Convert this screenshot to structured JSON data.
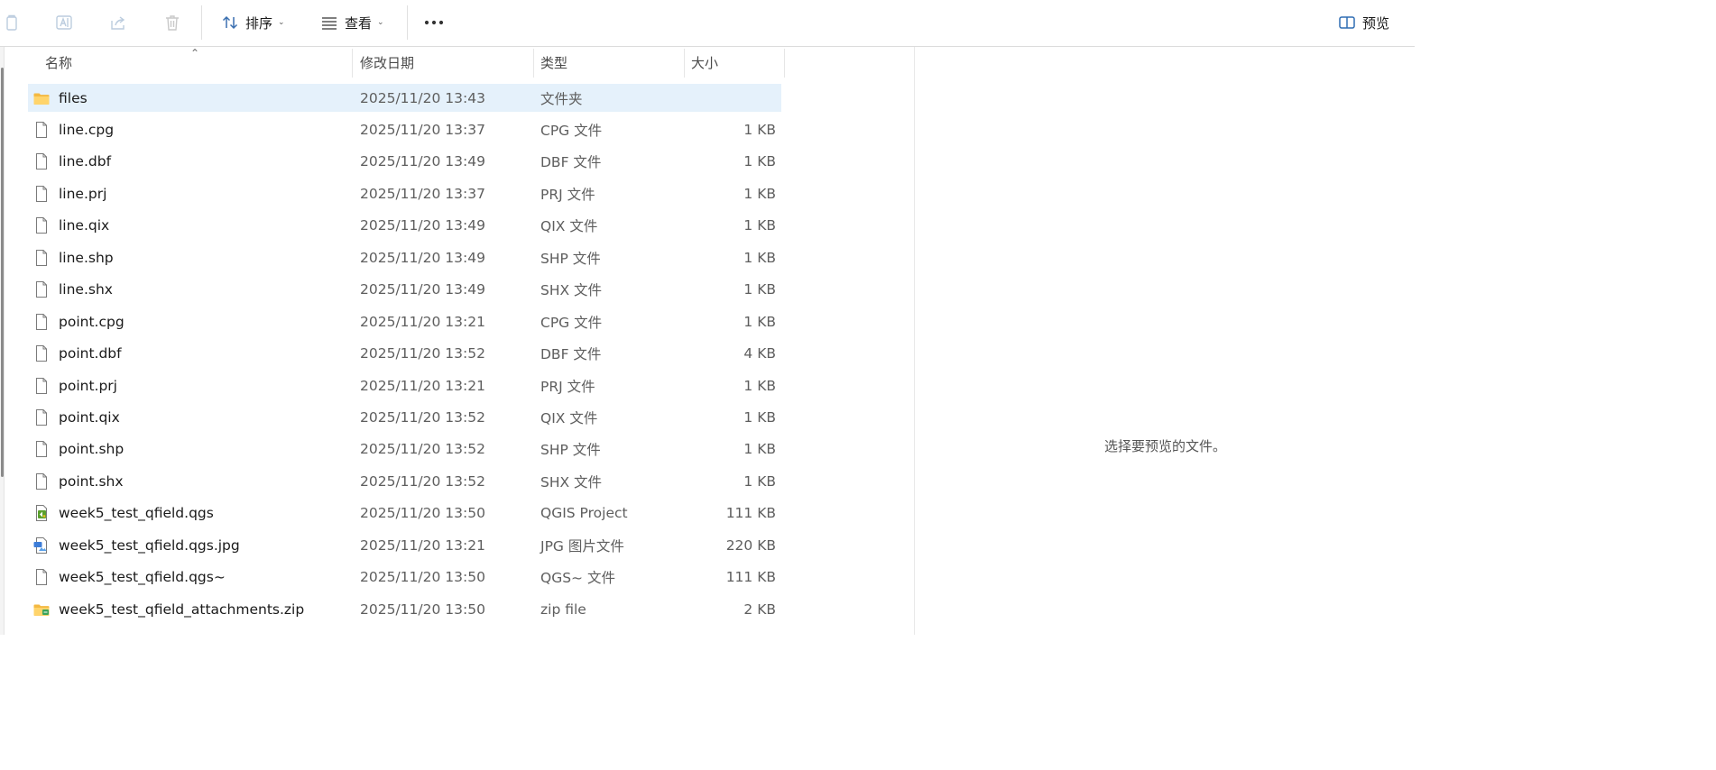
{
  "toolbar": {
    "sort_label": "排序",
    "view_label": "查看",
    "preview_label": "预览",
    "icons": {
      "copy": "copy-icon",
      "rename": "rename-icon",
      "share": "share-icon",
      "delete": "delete-icon",
      "sort": "sort-icon",
      "view": "view-icon",
      "more": "more-icon",
      "preview": "preview-pane-icon"
    }
  },
  "columns": {
    "name": "名称",
    "modified": "修改日期",
    "type": "类型",
    "size": "大小"
  },
  "files": [
    {
      "name": "files",
      "modified": "2025/11/20 13:43",
      "type": "文件夹",
      "size": "",
      "icon": "folder-icon",
      "selected": true
    },
    {
      "name": "line.cpg",
      "modified": "2025/11/20 13:37",
      "type": "CPG 文件",
      "size": "1 KB",
      "icon": "file-icon"
    },
    {
      "name": "line.dbf",
      "modified": "2025/11/20 13:49",
      "type": "DBF 文件",
      "size": "1 KB",
      "icon": "file-icon"
    },
    {
      "name": "line.prj",
      "modified": "2025/11/20 13:37",
      "type": "PRJ 文件",
      "size": "1 KB",
      "icon": "file-icon"
    },
    {
      "name": "line.qix",
      "modified": "2025/11/20 13:49",
      "type": "QIX 文件",
      "size": "1 KB",
      "icon": "file-icon"
    },
    {
      "name": "line.shp",
      "modified": "2025/11/20 13:49",
      "type": "SHP 文件",
      "size": "1 KB",
      "icon": "file-icon"
    },
    {
      "name": "line.shx",
      "modified": "2025/11/20 13:49",
      "type": "SHX 文件",
      "size": "1 KB",
      "icon": "file-icon"
    },
    {
      "name": "point.cpg",
      "modified": "2025/11/20 13:21",
      "type": "CPG 文件",
      "size": "1 KB",
      "icon": "file-icon"
    },
    {
      "name": "point.dbf",
      "modified": "2025/11/20 13:52",
      "type": "DBF 文件",
      "size": "4 KB",
      "icon": "file-icon"
    },
    {
      "name": "point.prj",
      "modified": "2025/11/20 13:21",
      "type": "PRJ 文件",
      "size": "1 KB",
      "icon": "file-icon"
    },
    {
      "name": "point.qix",
      "modified": "2025/11/20 13:52",
      "type": "QIX 文件",
      "size": "1 KB",
      "icon": "file-icon"
    },
    {
      "name": "point.shp",
      "modified": "2025/11/20 13:52",
      "type": "SHP 文件",
      "size": "1 KB",
      "icon": "file-icon"
    },
    {
      "name": "point.shx",
      "modified": "2025/11/20 13:52",
      "type": "SHX 文件",
      "size": "1 KB",
      "icon": "file-icon"
    },
    {
      "name": "week5_test_qfield.qgs",
      "modified": "2025/11/20 13:50",
      "type": "QGIS Project",
      "size": "111 KB",
      "icon": "qgis-project-icon"
    },
    {
      "name": "week5_test_qfield.qgs.jpg",
      "modified": "2025/11/20 13:21",
      "type": "JPG 图片文件",
      "size": "220 KB",
      "icon": "image-file-icon"
    },
    {
      "name": "week5_test_qfield.qgs~",
      "modified": "2025/11/20 13:50",
      "type": "QGS~ 文件",
      "size": "111 KB",
      "icon": "file-icon"
    },
    {
      "name": "week5_test_qfield_attachments.zip",
      "modified": "2025/11/20 13:50",
      "type": "zip file",
      "size": "2 KB",
      "icon": "zip-archive-icon"
    }
  ],
  "preview": {
    "message": "选择要预览的文件。"
  }
}
